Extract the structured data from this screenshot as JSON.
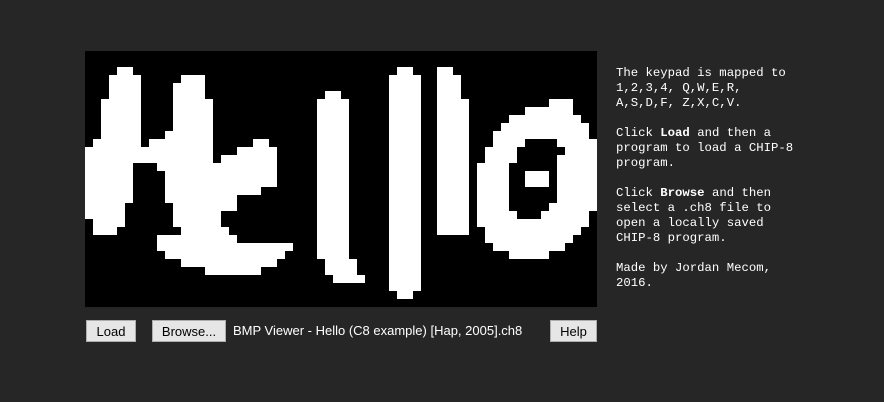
{
  "display": {
    "cols": 64,
    "rows": 32,
    "pixel_color": "#ffffff",
    "background": "#000000",
    "lit_pixels": [
      [
        2,
        4,
        5
      ],
      [
        2,
        39,
        40
      ],
      [
        2,
        44,
        45
      ],
      [
        3,
        3,
        6
      ],
      [
        3,
        12,
        14
      ],
      [
        3,
        38,
        41
      ],
      [
        3,
        44,
        46
      ],
      [
        4,
        3,
        6
      ],
      [
        4,
        11,
        14
      ],
      [
        4,
        38,
        41
      ],
      [
        4,
        44,
        46
      ],
      [
        5,
        3,
        6
      ],
      [
        5,
        11,
        14
      ],
      [
        5,
        30,
        31
      ],
      [
        5,
        38,
        41
      ],
      [
        5,
        44,
        46
      ],
      [
        6,
        2,
        6
      ],
      [
        6,
        11,
        15
      ],
      [
        6,
        29,
        32
      ],
      [
        6,
        38,
        41
      ],
      [
        6,
        44,
        47
      ],
      [
        6,
        58,
        60
      ],
      [
        7,
        2,
        6
      ],
      [
        7,
        11,
        15
      ],
      [
        7,
        29,
        32
      ],
      [
        7,
        38,
        41
      ],
      [
        7,
        44,
        47
      ],
      [
        7,
        55,
        60
      ],
      [
        8,
        2,
        6
      ],
      [
        8,
        11,
        15
      ],
      [
        8,
        29,
        32
      ],
      [
        8,
        38,
        41
      ],
      [
        8,
        44,
        47
      ],
      [
        8,
        53,
        61
      ],
      [
        9,
        2,
        6
      ],
      [
        9,
        11,
        15
      ],
      [
        9,
        29,
        32
      ],
      [
        9,
        38,
        41
      ],
      [
        9,
        44,
        47
      ],
      [
        9,
        52,
        62
      ],
      [
        10,
        2,
        6
      ],
      [
        10,
        10,
        15
      ],
      [
        10,
        29,
        32
      ],
      [
        10,
        38,
        41
      ],
      [
        10,
        44,
        47
      ],
      [
        10,
        51,
        62
      ],
      [
        11,
        1,
        6
      ],
      [
        11,
        8,
        15
      ],
      [
        11,
        21,
        22
      ],
      [
        11,
        29,
        32
      ],
      [
        11,
        38,
        41
      ],
      [
        11,
        44,
        47
      ],
      [
        11,
        51,
        54
      ],
      [
        11,
        59,
        63
      ],
      [
        12,
        0,
        15
      ],
      [
        12,
        19,
        23
      ],
      [
        12,
        29,
        32
      ],
      [
        12,
        38,
        41
      ],
      [
        12,
        44,
        47
      ],
      [
        12,
        50,
        53
      ],
      [
        12,
        60,
        63
      ],
      [
        13,
        0,
        15
      ],
      [
        13,
        17,
        23
      ],
      [
        13,
        29,
        32
      ],
      [
        13,
        38,
        41
      ],
      [
        13,
        44,
        47
      ],
      [
        13,
        50,
        53
      ],
      [
        13,
        59,
        63
      ],
      [
        14,
        0,
        5
      ],
      [
        14,
        9,
        15
      ],
      [
        14,
        16,
        19
      ],
      [
        14,
        20,
        23
      ],
      [
        14,
        29,
        32
      ],
      [
        14,
        38,
        41
      ],
      [
        14,
        44,
        47
      ],
      [
        14,
        49,
        52
      ],
      [
        14,
        59,
        63
      ],
      [
        15,
        0,
        5
      ],
      [
        15,
        10,
        14
      ],
      [
        15,
        15,
        18
      ],
      [
        15,
        19,
        23
      ],
      [
        15,
        29,
        32
      ],
      [
        15,
        38,
        41
      ],
      [
        15,
        44,
        47
      ],
      [
        15,
        49,
        52
      ],
      [
        15,
        55,
        57
      ],
      [
        15,
        59,
        63
      ],
      [
        16,
        0,
        5
      ],
      [
        16,
        10,
        14
      ],
      [
        16,
        15,
        17
      ],
      [
        16,
        18,
        23
      ],
      [
        16,
        29,
        32
      ],
      [
        16,
        38,
        41
      ],
      [
        16,
        44,
        47
      ],
      [
        16,
        49,
        52
      ],
      [
        16,
        55,
        57
      ],
      [
        16,
        59,
        63
      ],
      [
        17,
        0,
        5
      ],
      [
        17,
        10,
        21
      ],
      [
        17,
        29,
        32
      ],
      [
        17,
        38,
        41
      ],
      [
        17,
        44,
        47
      ],
      [
        17,
        49,
        52
      ],
      [
        17,
        59,
        63
      ],
      [
        18,
        0,
        5
      ],
      [
        18,
        10,
        18
      ],
      [
        18,
        29,
        32
      ],
      [
        18,
        38,
        41
      ],
      [
        18,
        44,
        47
      ],
      [
        18,
        49,
        52
      ],
      [
        18,
        59,
        63
      ],
      [
        19,
        0,
        4
      ],
      [
        19,
        11,
        18
      ],
      [
        19,
        29,
        32
      ],
      [
        19,
        38,
        41
      ],
      [
        19,
        44,
        47
      ],
      [
        19,
        49,
        52
      ],
      [
        19,
        58,
        63
      ],
      [
        20,
        0,
        4
      ],
      [
        20,
        11,
        16
      ],
      [
        20,
        29,
        32
      ],
      [
        20,
        38,
        41
      ],
      [
        20,
        44,
        47
      ],
      [
        20,
        49,
        53
      ],
      [
        20,
        57,
        62
      ],
      [
        21,
        1,
        4
      ],
      [
        21,
        11,
        16
      ],
      [
        21,
        29,
        32
      ],
      [
        21,
        38,
        41
      ],
      [
        21,
        44,
        47
      ],
      [
        21,
        49,
        62
      ],
      [
        22,
        1,
        3
      ],
      [
        22,
        12,
        17
      ],
      [
        22,
        29,
        32
      ],
      [
        22,
        38,
        41
      ],
      [
        22,
        44,
        47
      ],
      [
        22,
        50,
        61
      ],
      [
        23,
        9,
        11
      ],
      [
        23,
        12,
        18
      ],
      [
        23,
        29,
        32
      ],
      [
        23,
        38,
        41
      ],
      [
        23,
        50,
        60
      ],
      [
        24,
        9,
        25
      ],
      [
        24,
        29,
        32
      ],
      [
        24,
        38,
        41
      ],
      [
        24,
        51,
        59
      ],
      [
        25,
        10,
        24
      ],
      [
        25,
        29,
        32
      ],
      [
        25,
        38,
        41
      ],
      [
        25,
        53,
        57
      ],
      [
        26,
        12,
        23
      ],
      [
        26,
        30,
        33
      ],
      [
        26,
        38,
        41
      ],
      [
        27,
        15,
        21
      ],
      [
        27,
        30,
        33
      ],
      [
        27,
        38,
        41
      ],
      [
        28,
        31,
        34
      ],
      [
        28,
        38,
        41
      ],
      [
        29,
        38,
        41
      ],
      [
        30,
        39,
        40
      ]
    ]
  },
  "buttons": {
    "load": "Load",
    "browse": "Browse...",
    "help": "Help"
  },
  "filename": "BMP Viewer - Hello (C8 example) [Hap, 2005].ch8",
  "info": {
    "keypad_line1": "The keypad is mapped to",
    "keypad_line2": "1,2,3,4, Q,W,E,R,",
    "keypad_line3": "A,S,D,F, Z,X,C,V.",
    "load_pre": "Click ",
    "load_bold": "Load",
    "load_post": " and then a",
    "load_line2": "program to load a CHIP-8",
    "load_line3": "program.",
    "browse_pre": "Click ",
    "browse_bold": "Browse",
    "browse_post": " and then",
    "browse_line2": "select a .ch8 file to",
    "browse_line3": "open a locally saved",
    "browse_line4": "CHIP-8 program.",
    "credit_line1": "Made by Jordan Mecom,",
    "credit_line2": "2016."
  }
}
